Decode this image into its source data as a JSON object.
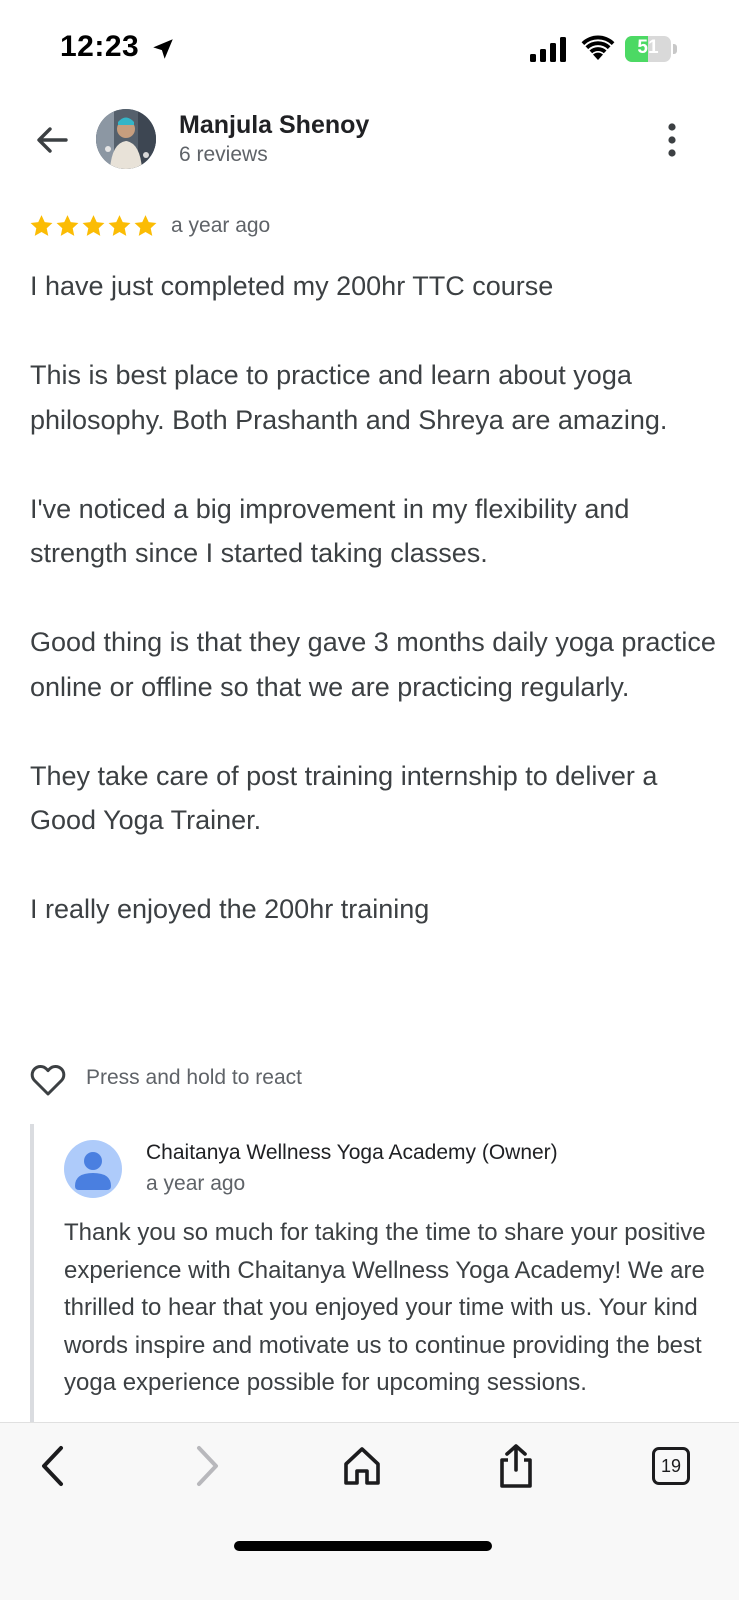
{
  "status_bar": {
    "time": "12:23",
    "battery_level": "51",
    "battery_charging": true,
    "location_icon": "location-arrow-icon",
    "signal_icon": "cellular-signal-icon",
    "wifi_icon": "wifi-icon"
  },
  "header": {
    "back_icon": "back-arrow-icon",
    "reviewer_name": "Manjula Shenoy",
    "review_count": "6 reviews",
    "menu_icon": "more-vertical-icon"
  },
  "review": {
    "rating": 5,
    "max_rating": 5,
    "star_color": "#fbbc04",
    "time_ago": "a year ago",
    "paragraphs": [
      "I have just completed my 200hr TTC course",
      "This is best place to practice and learn about yoga philosophy. Both Prashanth  and Shreya are amazing.",
      "I've noticed a big improvement in my flexibility and strength since I started taking classes.",
      "Good thing is that they gave 3 months daily yoga practice online or offline so that we are practicing regularly.",
      "They take care of post training internship to deliver a Good Yoga Trainer.",
      "I really enjoyed the 200hr training"
    ]
  },
  "reaction": {
    "icon": "heart-outline-icon",
    "label": "Press and hold to react"
  },
  "owner_response": {
    "name": "Chaitanya Wellness Yoga Academy (Owner)",
    "time_ago": "a year ago",
    "text": "Thank you so much for taking the time to share your positive experience with Chaitanya Wellness Yoga Academy! We are thrilled to hear that you enjoyed your time with us. Your kind words inspire and motivate us to continue providing the best yoga experience possible for upcoming sessions."
  },
  "browser_bar": {
    "back_icon": "chevron-left-icon",
    "forward_icon": "chevron-right-icon",
    "home_icon": "home-icon",
    "share_icon": "share-icon",
    "tab_count": "19"
  },
  "colors": {
    "text_primary": "#202124",
    "text_body": "#3c4043",
    "text_secondary": "#5f6368",
    "battery_green": "#4cd964",
    "owner_avatar_bg": "#aecbfa",
    "owner_avatar_fg": "#4a7fe0"
  }
}
